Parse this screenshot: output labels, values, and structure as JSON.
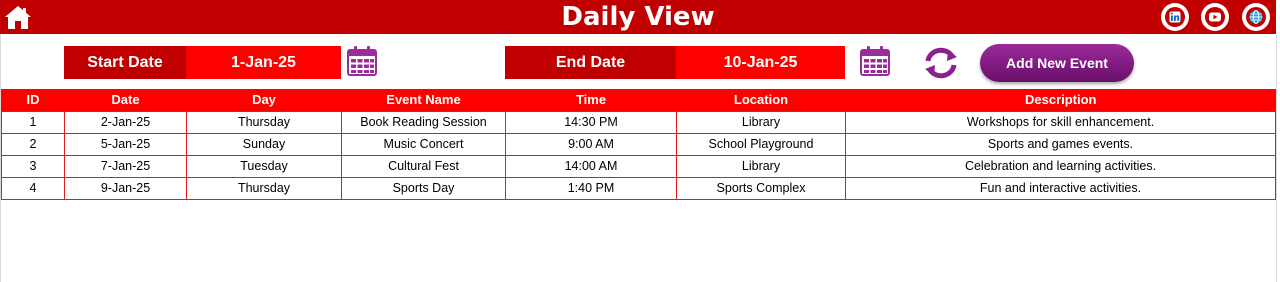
{
  "header": {
    "title": "Daily View",
    "home_icon": "home-icon",
    "social": [
      "linkedin-icon",
      "youtube-icon",
      "globe-icon"
    ]
  },
  "filters": {
    "start_label": "Start Date",
    "start_value": "1-Jan-25",
    "end_label": "End Date",
    "end_value": "10-Jan-25",
    "calendar_icon": "calendar-icon",
    "refresh_icon": "refresh-icon",
    "add_button": "Add New Event"
  },
  "table": {
    "columns": [
      "ID",
      "Date",
      "Day",
      "Event Name",
      "Time",
      "Location",
      "Description"
    ],
    "rows": [
      [
        "1",
        "2-Jan-25",
        "Thursday",
        "Book Reading Session",
        "14:30 PM",
        "Library",
        "Workshops for skill enhancement."
      ],
      [
        "2",
        "5-Jan-25",
        "Sunday",
        "Music Concert",
        "9:00 AM",
        "School Playground",
        "Sports and games events."
      ],
      [
        "3",
        "7-Jan-25",
        "Tuesday",
        "Cultural Fest",
        "14:00 AM",
        "Library",
        "Celebration and learning activities."
      ],
      [
        "4",
        "9-Jan-25",
        "Thursday",
        "Sports Day",
        "1:40 PM",
        "Sports Complex",
        "Fun and interactive activities."
      ]
    ]
  },
  "colors": {
    "header_red": "#c00000",
    "bright_red": "#ff0000",
    "purple": "#7b1c7b"
  }
}
